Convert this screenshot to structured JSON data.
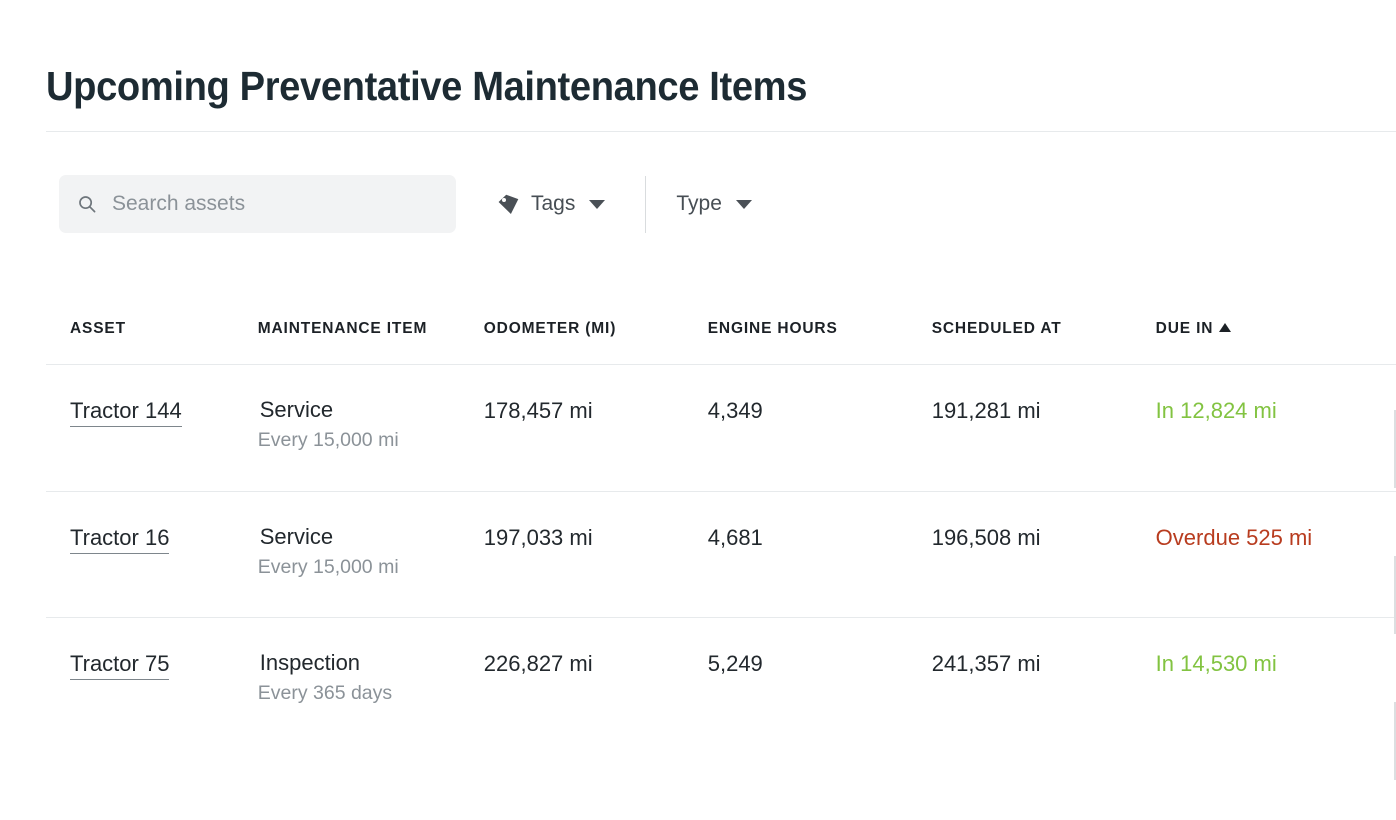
{
  "page": {
    "title": "Upcoming Preventative Maintenance Items"
  },
  "filters": {
    "search": {
      "placeholder": "Search assets",
      "value": "",
      "icon": "search-icon"
    },
    "tags": {
      "label": "Tags",
      "icon": "tag-icon",
      "caret": "chevron-down-icon"
    },
    "type": {
      "label": "Type",
      "caret": "chevron-down-icon"
    }
  },
  "table": {
    "columns": [
      {
        "key": "asset",
        "label": "ASSET"
      },
      {
        "key": "item",
        "label": "MAINTENANCE ITEM"
      },
      {
        "key": "odo",
        "label": "ODOMETER (MI)"
      },
      {
        "key": "hours",
        "label": "ENGINE HOURS"
      },
      {
        "key": "sched",
        "label": "SCHEDULED AT"
      },
      {
        "key": "due",
        "label": "DUE IN"
      }
    ],
    "sort": {
      "column": "DUE IN",
      "direction": "ascending",
      "glyph": "▲"
    },
    "rows": [
      {
        "asset": "Tractor 144",
        "item": "Service",
        "item_sub": "Every 15,000 mi",
        "odometer": "178,457 mi",
        "engine_hours": "4,349",
        "scheduled_at": "191,281 mi",
        "due_in": "In 12,824 mi",
        "due_state": "ok"
      },
      {
        "asset": "Tractor 16",
        "item": "Service",
        "item_sub": "Every 15,000 mi",
        "odometer": "197,033 mi",
        "engine_hours": "4,681",
        "scheduled_at": "196,508 mi",
        "due_in": "Overdue 525 mi",
        "due_state": "overdue"
      },
      {
        "asset": "Tractor 75",
        "item": "Inspection",
        "item_sub": "Every 365 days",
        "odometer": "226,827 mi",
        "engine_hours": "5,249",
        "scheduled_at": "241,357 mi",
        "due_in": "In 14,530 mi",
        "due_state": "ok"
      }
    ]
  },
  "colors": {
    "title": "#1d2b33",
    "text": "#22282d",
    "muted": "#8b9298",
    "divider": "#e7eaec",
    "due_ok": "#82c341",
    "due_overdue": "#b83c1f",
    "search_bg": "#f2f3f4"
  }
}
